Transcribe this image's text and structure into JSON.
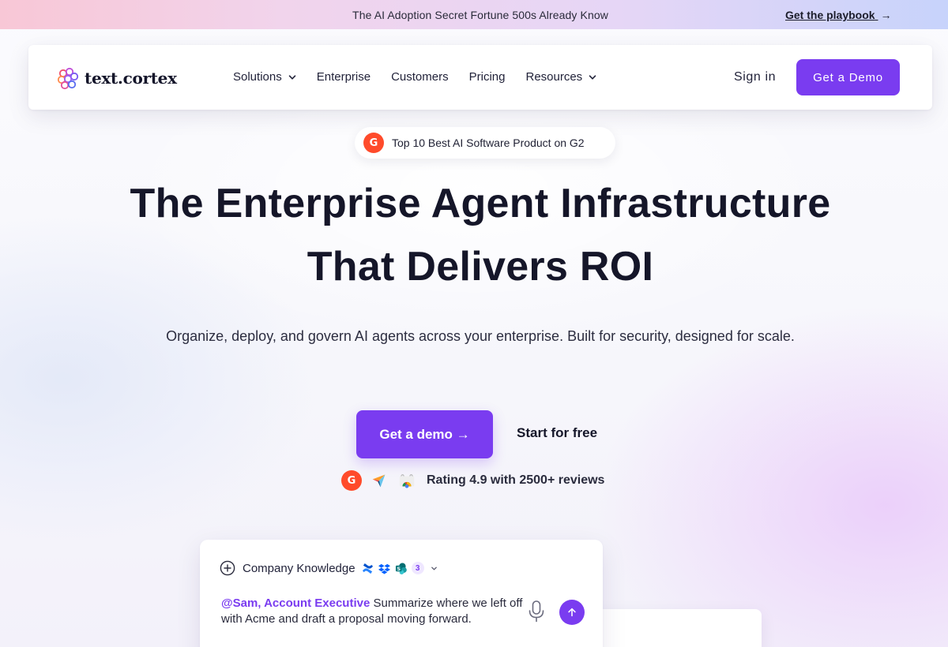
{
  "announcement": {
    "text": "The AI Adoption Secret Fortune 500s Already Know",
    "link_label": "Get the playbook",
    "link_arrow": "→"
  },
  "nav": {
    "logo_text": "text.cortex",
    "items": [
      {
        "label": "Solutions",
        "has_dropdown": true
      },
      {
        "label": "Enterprise",
        "has_dropdown": false
      },
      {
        "label": "Customers",
        "has_dropdown": false
      },
      {
        "label": "Pricing",
        "has_dropdown": false
      },
      {
        "label": "Resources",
        "has_dropdown": true
      }
    ],
    "sign_in": "Sign in",
    "demo_button": "Get a Demo"
  },
  "badge": {
    "icon_text": "G",
    "text": "Top 10 Best AI Software Product on G2"
  },
  "hero": {
    "title_line1": "The Enterprise Agent Infrastructure",
    "title_line2": "That Delivers ROI",
    "subtitle": "Organize, deploy, and govern AI agents across your enterprise. Built for security, designed for scale.",
    "cta_primary": "Get a demo →",
    "cta_secondary": "Start for free",
    "rating_text": "Rating 4.9 with 2500+ reviews",
    "rating_icons": [
      "g2-icon",
      "capterra-icon",
      "chrome-web-store-icon"
    ]
  },
  "chat": {
    "knowledge_label": "Company Knowledge",
    "integration_icons": [
      "confluence-icon",
      "dropbox-icon",
      "sharepoint-icon"
    ],
    "integration_count": "3",
    "mention": "@Sam, Account Executive",
    "prompt": " Summarize where we left off with Acme and draft a proposal moving forward."
  },
  "colors": {
    "accent": "#7a3cf0",
    "heading": "#151629",
    "g2_red": "#ff4b2b"
  }
}
